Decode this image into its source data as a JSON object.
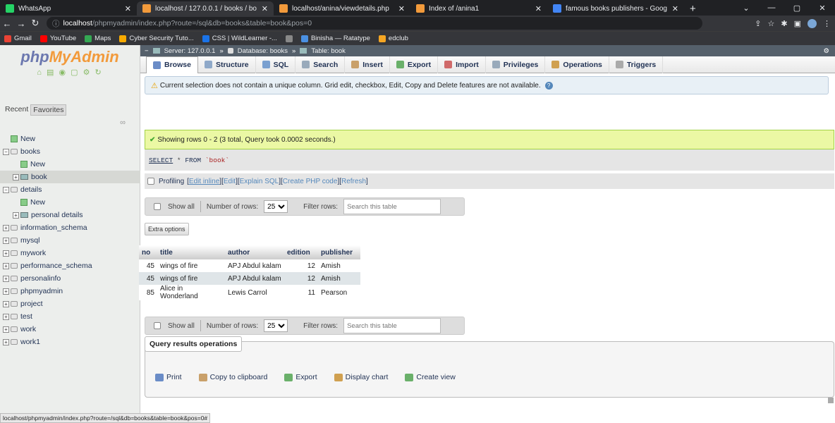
{
  "browser": {
    "tabs": [
      {
        "title": "WhatsApp",
        "color": "#25d366",
        "active": false
      },
      {
        "title": "localhost / 127.0.0.1 / books / bo",
        "color": "#f29a3b",
        "active": true
      },
      {
        "title": "localhost/anina/viewdetails.php",
        "color": "#f29a3b",
        "active": false
      },
      {
        "title": "Index of /anina1",
        "color": "#f29a3b",
        "active": false
      },
      {
        "title": "famous books publishers - Goog",
        "color": "#4285f4",
        "active": false
      }
    ],
    "url_host": "localhost",
    "url_path": "/phpmyadmin/index.php?route=/sql&db=books&table=book&pos=0",
    "bookmarks": [
      {
        "label": "Gmail",
        "color": "#ea4335"
      },
      {
        "label": "YouTube",
        "color": "#ff0000"
      },
      {
        "label": "Maps",
        "color": "#34a853"
      },
      {
        "label": "Cyber Security Tuto...",
        "color": "#f9ab00"
      },
      {
        "label": "CSS | WildLearner -...",
        "color": "#1a73e8"
      },
      {
        "label": "",
        "color": "#888888"
      },
      {
        "label": "Binisha — Ratatype",
        "color": "#4a90e2"
      },
      {
        "label": "edclub",
        "color": "#f5a623"
      }
    ]
  },
  "sidebar": {
    "logo_php": "php",
    "logo_myadmin": "MyAdmin",
    "recent": "Recent",
    "favorites": "Favorites",
    "tree": [
      {
        "label": "New",
        "level": 0,
        "kind": "new",
        "pm": ""
      },
      {
        "label": "books",
        "level": 0,
        "kind": "db",
        "pm": "−"
      },
      {
        "label": "New",
        "level": 1,
        "kind": "new",
        "pm": ""
      },
      {
        "label": "book",
        "level": 1,
        "kind": "tbl",
        "pm": "+",
        "selected": true
      },
      {
        "label": "details",
        "level": 0,
        "kind": "db",
        "pm": "−"
      },
      {
        "label": "New",
        "level": 1,
        "kind": "new",
        "pm": ""
      },
      {
        "label": "personal details",
        "level": 1,
        "kind": "tbl",
        "pm": "+"
      },
      {
        "label": "information_schema",
        "level": 0,
        "kind": "db",
        "pm": "+"
      },
      {
        "label": "mysql",
        "level": 0,
        "kind": "db",
        "pm": "+"
      },
      {
        "label": "mywork",
        "level": 0,
        "kind": "db",
        "pm": "+"
      },
      {
        "label": "performance_schema",
        "level": 0,
        "kind": "db",
        "pm": "+"
      },
      {
        "label": "personalinfo",
        "level": 0,
        "kind": "db",
        "pm": "+"
      },
      {
        "label": "phpmyadmin",
        "level": 0,
        "kind": "db",
        "pm": "+"
      },
      {
        "label": "project",
        "level": 0,
        "kind": "db",
        "pm": "+"
      },
      {
        "label": "test",
        "level": 0,
        "kind": "db",
        "pm": "+"
      },
      {
        "label": "work",
        "level": 0,
        "kind": "db",
        "pm": "+"
      },
      {
        "label": "work1",
        "level": 0,
        "kind": "db",
        "pm": "+"
      }
    ]
  },
  "breadcrumb": {
    "server": "Server: 127.0.0.1",
    "database": "Database: books",
    "table": "Table: book"
  },
  "tabs": [
    {
      "label": "Browse",
      "color": "#6a8cc7",
      "active": true
    },
    {
      "label": "Structure",
      "color": "#8fa9c9"
    },
    {
      "label": "SQL",
      "color": "#7aa0d0"
    },
    {
      "label": "Search",
      "color": "#9ab"
    },
    {
      "label": "Insert",
      "color": "#c9a06a"
    },
    {
      "label": "Export",
      "color": "#6ab06a"
    },
    {
      "label": "Import",
      "color": "#d06a6a"
    },
    {
      "label": "Privileges",
      "color": "#9ab"
    },
    {
      "label": "Operations",
      "color": "#d0a050"
    },
    {
      "label": "Triggers",
      "color": "#aaa"
    }
  ],
  "notice": "Current selection does not contain a unique column. Grid edit, checkbox, Edit, Copy and Delete features are not available.",
  "success": "Showing rows 0 - 2 (3 total, Query took 0.0002 seconds.)",
  "sql": {
    "select": "SELECT",
    "star": " * ",
    "from": "FROM",
    "table": " `book`"
  },
  "profiling": {
    "label": "Profiling",
    "links": [
      "Edit inline",
      "Edit",
      "Explain SQL",
      "Create PHP code",
      "Refresh"
    ]
  },
  "navrow": {
    "show_all": "Show all",
    "number_of_rows": "Number of rows:",
    "rows_value": "25",
    "filter_rows": "Filter rows:",
    "filter_placeholder": "Search this table"
  },
  "extra_options": "Extra options",
  "table": {
    "headers": [
      "no",
      "title",
      "author",
      "edition",
      "publisher"
    ],
    "rows": [
      [
        "45",
        "wings of fire",
        "APJ Abdul kalam",
        "12",
        "Amish"
      ],
      [
        "45",
        "wings of fire",
        "APJ Abdul kalam",
        "12",
        "Amish"
      ],
      [
        "85",
        "Alice in Wonderland",
        "Lewis Carrol",
        "11",
        "Pearson"
      ]
    ]
  },
  "qro": {
    "legend": "Query results operations",
    "actions": [
      {
        "label": "Print",
        "color": "#6a8cc7"
      },
      {
        "label": "Copy to clipboard",
        "color": "#c9a06a"
      },
      {
        "label": "Export",
        "color": "#6ab06a"
      },
      {
        "label": "Display chart",
        "color": "#d0a050"
      },
      {
        "label": "Create view",
        "color": "#6ab06a"
      }
    ]
  },
  "statusbar": "localhost/phpmyadmin/index.php?route=/sql&db=books&table=book&pos=0#"
}
